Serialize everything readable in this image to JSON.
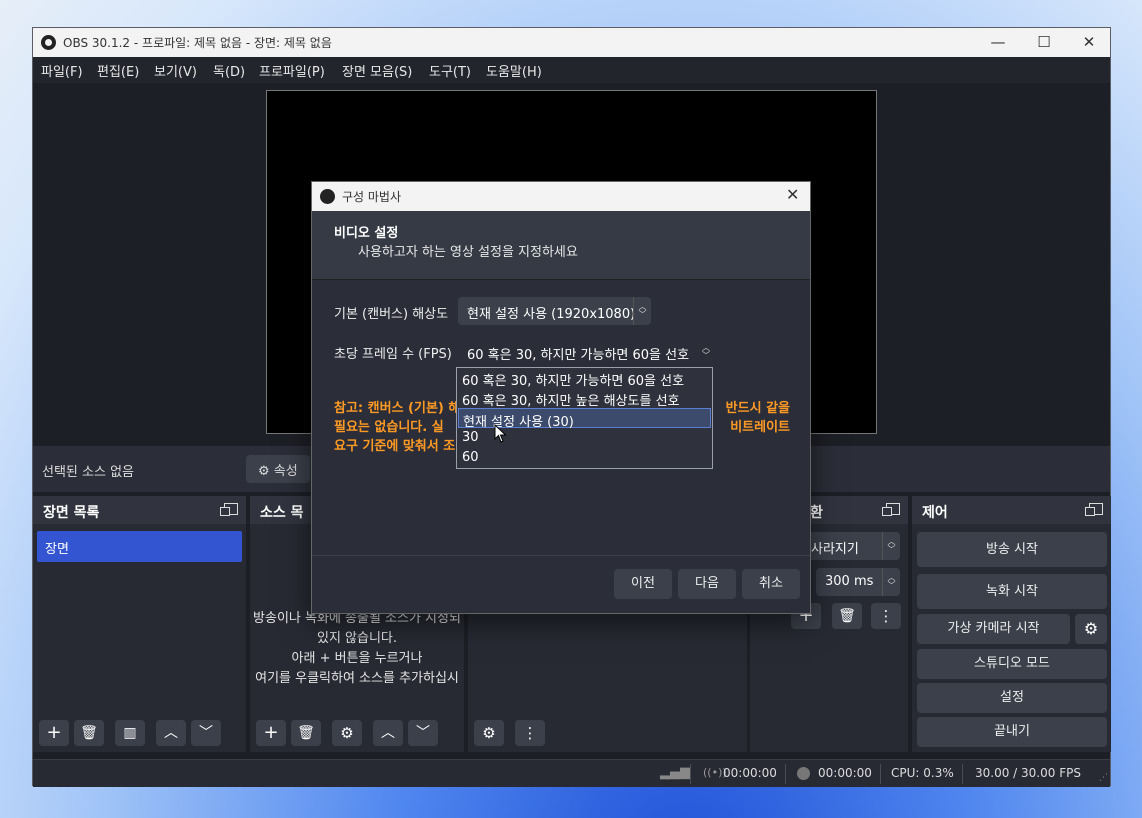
{
  "window": {
    "title": "OBS 30.1.2 - 프로파일: 제목 없음 - 장면: 제목 없음",
    "minimize": "—",
    "maximize": "☐",
    "close": "✕"
  },
  "menu": [
    "파일(F)",
    "편집(E)",
    "보기(V)",
    "독(D)",
    "프로파일(P)",
    "장면 모음(S)",
    "도구(T)",
    "도움말(H)"
  ],
  "source_bar": {
    "no_selection": "선택된 소스 없음",
    "properties": "속성"
  },
  "docks": {
    "scenes": {
      "title": "장면 목록",
      "items": [
        "장면"
      ]
    },
    "sources": {
      "title": "소스 목",
      "empty_lines": [
        "방송이나 녹화에 송출될 소스가 지정되",
        "있지 않습니다.",
        "아래 + 버튼을 누르거나",
        "여기를 우클릭하여 소스를 추가하십시"
      ]
    },
    "transitions": {
      "title": "환",
      "transition": "사라지기",
      "duration": "300 ms"
    },
    "controls": {
      "title": "제어",
      "buttons": [
        "방송 시작",
        "녹화 시작",
        "가상 카메라 시작",
        "스튜디오 모드",
        "설정",
        "끝내기"
      ]
    }
  },
  "status": {
    "stream_time": "00:00:00",
    "record_time": "00:00:00",
    "cpu": "CPU: 0.3%",
    "fps": "30.00 / 30.00 FPS"
  },
  "wizard": {
    "title": "구성 마법사",
    "heading": "비디오 설정",
    "subheading": "사용하고자 하는 영상 설정을 지정하세요",
    "resolution_label": "기본 (캔버스) 해상도",
    "resolution_value": "현재 설정 사용 (1920x1080)",
    "fps_label": "초당 프레임 수 (FPS)",
    "fps_value": "60 혹은 30, 하지만 가능하면 60을 선호",
    "fps_options": [
      "60 혹은 30, 하지만 가능하면 60을 선호",
      "60 혹은 30, 하지만 높은 해상도를 선호",
      "현재 설정 사용 (30)",
      "30",
      "60"
    ],
    "fps_selected_index": 2,
    "note_left": [
      "참고: 캔버스 (기본) 해",
      "필요는 없습니다. 실",
      "요구 기준에 맞춰서 조"
    ],
    "note_right": [
      "반드시 같을",
      "비트레이트"
    ],
    "buttons": {
      "back": "이전",
      "next": "다음",
      "cancel": "취소"
    }
  },
  "icons": {
    "gear": "gear-icon",
    "plus": "plus-icon",
    "trash": "trash-icon",
    "filter": "filter-icon",
    "up": "chevron-up-icon",
    "down": "chevron-down-icon",
    "dots": "more-icon",
    "signal": "signal-icon",
    "stream": "stream-icon",
    "record": "record-icon"
  }
}
